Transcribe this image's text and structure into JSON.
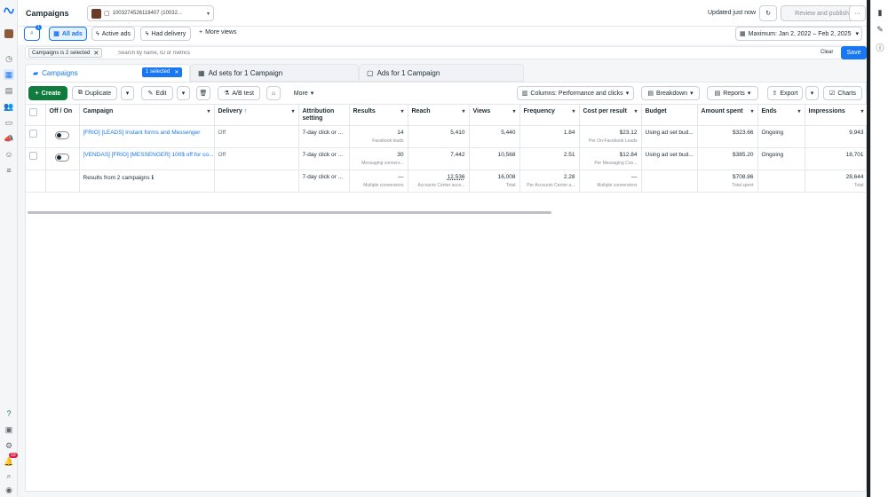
{
  "header": {
    "title": "Campaigns",
    "account_label": "1003274526118407 (10032...",
    "updated": "Updated just now",
    "review_publish": "Review and publish",
    "more": "···"
  },
  "filters": {
    "search_count": "1",
    "all_ads": "All ads",
    "active_ads": "Active ads",
    "had_delivery": "Had delivery",
    "more_views": "More views",
    "date_range": "Maximum: Jan 2, 2022 – Feb 2, 2025"
  },
  "search": {
    "chip_label": "Campaigns is 2 selected",
    "placeholder": "Search by name, ID or metrics",
    "clear": "Clear",
    "save": "Save"
  },
  "tabs": {
    "campaigns": "Campaigns",
    "selected_badge": "1 selected",
    "adsets": "Ad sets for 1 Campaign",
    "ads": "Ads for 1 Campaign"
  },
  "toolbar": {
    "create": "Create",
    "duplicate": "Duplicate",
    "edit": "Edit",
    "ab_test": "A/B test",
    "more": "More",
    "columns": "Columns: Performance and clicks",
    "breakdown": "Breakdown",
    "reports": "Reports",
    "export": "Export",
    "charts": "Charts"
  },
  "table": {
    "headers": {
      "offon": "Off / On",
      "campaign": "Campaign",
      "delivery": "Delivery",
      "attribution": "Attribution setting",
      "results": "Results",
      "reach": "Reach",
      "views": "Views",
      "frequency": "Frequency",
      "cpr": "Cost per result",
      "budget": "Budget",
      "amount": "Amount spent",
      "ends": "Ends",
      "impressions": "Impressions"
    },
    "rows": [
      {
        "name": "[FRIO] [LEADS] Instant forms and Messenger",
        "delivery": "Off",
        "attribution": "7-day click or ...",
        "results": "14",
        "results_sub": "Facebook leads",
        "reach": "5,410",
        "views": "5,440",
        "frequency": "1.84",
        "cpr": "$23.12",
        "cpr_sub": "Per On-Facebook Leads",
        "budget": "Using ad set bud...",
        "amount": "$323.66",
        "ends": "Ongoing",
        "impressions": "9,943"
      },
      {
        "name": "[VENDAS] [FRIO] [MESSENGER] 100$ off for co...",
        "delivery": "Off",
        "attribution": "7-day click or ...",
        "results": "30",
        "results_sub": "Messaging convers...",
        "reach": "7,442",
        "views": "10,568",
        "frequency": "2.51",
        "cpr": "$12.84",
        "cpr_sub": "Per Messaging Con...",
        "budget": "Using ad set bud...",
        "amount": "$385.20",
        "ends": "Ongoing",
        "impressions": "18,701"
      }
    ],
    "totals": {
      "label": "Results from 2 campaigns",
      "attribution": "7-day click or ...",
      "results": "—",
      "results_sub": "Multiple conversions",
      "reach": "12,536",
      "reach_sub": "Accounts Center acco...",
      "views": "16,008",
      "views_sub": "Total",
      "frequency": "2.28",
      "frequency_sub": "Per Accounts Center a...",
      "cpr": "—",
      "cpr_sub": "Multiple conversions",
      "amount": "$708.86",
      "amount_sub": "Total spent",
      "impressions": "28,644",
      "impressions_sub": "Total"
    }
  },
  "leftrail": {
    "notif_count": "10"
  },
  "colors": {
    "accent": "#1877f2",
    "create": "#0f7b3c",
    "selected": "#1877f2"
  }
}
